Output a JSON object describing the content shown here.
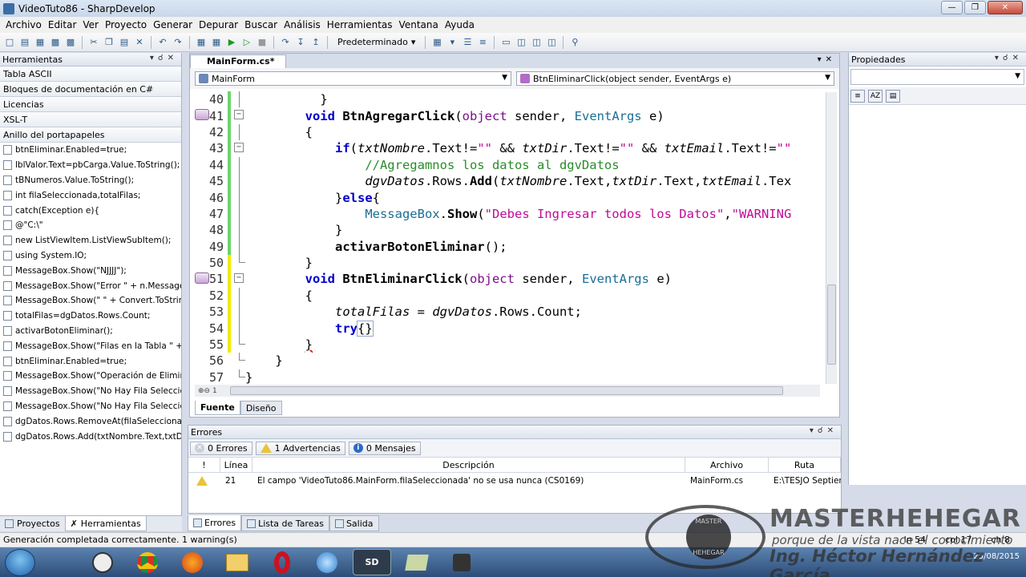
{
  "window": {
    "title": "VideoTuto86 - SharpDevelop"
  },
  "menu": [
    "Archivo",
    "Editar",
    "Ver",
    "Proyecto",
    "Generar",
    "Depurar",
    "Buscar",
    "Análisis",
    "Herramientas",
    "Ventana",
    "Ayuda"
  ],
  "toolbar": {
    "config_combo": "Predeterminado"
  },
  "tools_panel": {
    "title": "Herramientas",
    "categories": [
      "Tabla ASCII",
      "Bloques de documentación en C#",
      "Licencias",
      "XSL-T",
      "Anillo del portapapeles"
    ],
    "clipboard": [
      "btnEliminar.Enabled=true;",
      "lblValor.Text=pbCarga.Value.ToString();",
      "tBNumeros.Value.ToString();",
      "int filaSeleccionada,totalFilas;",
      "catch(Exception e){",
      "@\"C:\\\"",
      "new ListViewItem.ListViewSubItem();",
      "using System.IO;",
      "MessageBox.Show(\"NJJJJ\");",
      "MessageBox.Show(\"Error \" + n.Message,\"",
      "MessageBox.Show(\" \" + Convert.ToString",
      "totalFilas=dgDatos.Rows.Count;",
      "activarBotonEliminar();",
      "MessageBox.Show(\"Filas en la Tabla \" + to",
      "btnEliminar.Enabled=true;",
      "MessageBox.Show(\"Operación de Elimina",
      "MessageBox.Show(\"No Hay Fila Seleccior",
      "MessageBox.Show(\"No Hay Fila Seleccior",
      "dgDatos.Rows.RemoveAt(filaSeleccionada",
      "dgDatos.Rows.Add(txtNombre.Text,txtDir"
    ],
    "bottom_tabs": [
      "Proyectos",
      "Herramientas"
    ]
  },
  "editor": {
    "tab": "MainForm.cs*",
    "class_combo": "MainForm",
    "member_combo": "BtnEliminarClick(object sender, EventArgs e)",
    "zoom": "1",
    "view_tabs": [
      "Fuente",
      "Diseño"
    ],
    "line_numbers": [
      "40",
      "41",
      "42",
      "43",
      "44",
      "45",
      "46",
      "47",
      "48",
      "49",
      "50",
      "51",
      "52",
      "53",
      "54",
      "55",
      "56",
      "57"
    ],
    "code": {
      "l40": "}",
      "l41_kw": "void",
      "l41_fn": "BtnAgregarClick",
      "l41_obj": "object",
      "l41_sender": " sender, ",
      "l41_args": "EventArgs",
      "l41_e": " e)",
      "l42": "{",
      "l43_kw": "if",
      "l43_rest_a": "(",
      "l43_v1": "txtNombre",
      "l43_p1": ".Text!=",
      "l43_s1": "\"\"",
      "l43_and1": " && ",
      "l43_v2": "txtDir",
      "l43_p2": ".Text!=",
      "l43_s2": "\"\"",
      "l43_and2": " && ",
      "l43_v3": "txtEmail",
      "l43_p3": ".Text!=",
      "l43_s3": "\"\"",
      "l44": "//Agregamnos los datos al dgvDatos",
      "l45_v": "dgvDatos",
      "l45_a": ".Rows.",
      "l45_fn": "Add",
      "l45_b": "(",
      "l45_x1": "txtNombre",
      "l45_c": ".Text,",
      "l45_x2": "txtDir",
      "l45_d": ".Text,",
      "l45_x3": "txtEmail",
      "l45_e": ".Tex",
      "l46_a": "}",
      "l46_kw": "else",
      "l46_b": "{",
      "l47_cls": "MessageBox",
      "l47_a": ".",
      "l47_fn": "Show",
      "l47_b": "(",
      "l47_s1": "\"Debes Ingresar todos los Datos\"",
      "l47_c": ",",
      "l47_s2": "\"WARNING",
      "l48": "}",
      "l49_fn": "activarBotonEliminar",
      "l49_b": "();",
      "l50": "}",
      "l51_kw": "void",
      "l51_fn": "BtnEliminarClick",
      "l51_obj": "object",
      "l51_sender": " sender, ",
      "l51_args": "EventArgs",
      "l51_e": " e)",
      "l52": "{",
      "l53_v": "totalFilas",
      "l53_a": " = ",
      "l53_v2": "dgvDatos",
      "l53_b": ".Rows.Count;",
      "l54_kw": "try",
      "l54_b": "{}",
      "l55": "}",
      "l56": "}",
      "l57": "}"
    }
  },
  "errors_panel": {
    "title": "Errores",
    "filters": {
      "errors": "0 Errores",
      "warnings": "1 Advertencias",
      "messages": "0 Mensajes"
    },
    "columns": [
      "!",
      "Línea",
      "Descripción",
      "Archivo",
      "Ruta"
    ],
    "rows": [
      {
        "line": "21",
        "description": "El campo 'VideoTuto86.MainForm.filaSeleccionada' no se usa nunca (CS0169)",
        "file": "MainForm.cs",
        "path": "E:\\TESJO Septiem..."
      }
    ],
    "bottom_tabs": [
      "Errores",
      "Lista de Tareas",
      "Salida"
    ]
  },
  "properties_panel": {
    "title": "Propiedades"
  },
  "statusbar": {
    "message": "Generación completada correctamente. 1 warning(s)",
    "line": "ln 54",
    "col": "col 17",
    "ch": "ch 8"
  },
  "taskbar": {
    "sd_label": "SD",
    "date": "25/08/2015"
  },
  "watermark": {
    "badge_top": "MASTER",
    "badge_bottom": "HEHEGAR",
    "title": "MASTERHEHEGAR",
    "subtitle": "porque de la vista nace el conocimiento",
    "author": "Ing. Héctor Hernández García"
  },
  "colors": {
    "titlebar": "#c8d7ea",
    "keyword": "#0000cc",
    "string": "#c10a98",
    "comment": "#2a8c2a",
    "change_marker_saved": "#6cd46c",
    "change_marker_unsaved": "#f2e800"
  }
}
